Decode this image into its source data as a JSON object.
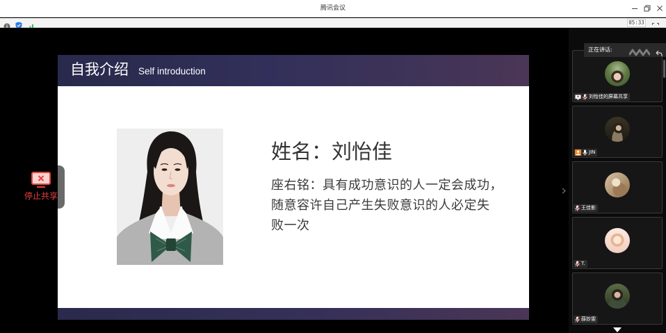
{
  "window": {
    "title": "腾讯会议"
  },
  "toolbar": {
    "timer": "05:33"
  },
  "slide": {
    "title_cn": "自我介绍",
    "title_en": "Self introduction",
    "name_line": "姓名：刘怡佳",
    "motto_lines": [
      "座右铭：具有成功意识的人一定会成功，",
      "随意容许自己产生失败意识的人必定失",
      "败一次"
    ]
  },
  "share_control": {
    "stop_label": "停止共享"
  },
  "speaker_panel": {
    "header": "正在讲话:",
    "participants": [
      {
        "name": "刘怡佳的屏幕共享",
        "badge_icon": "screen-share-icon",
        "mic_icon": "mic-muted-icon"
      },
      {
        "name": "JIN",
        "badge_icon": "host-person-icon",
        "mic_icon": "mic-icon"
      },
      {
        "name": "王佳影",
        "mic_icon": "mic-muted-icon"
      },
      {
        "name": "T.",
        "mic_icon": "mic-muted-icon"
      },
      {
        "name": "薛妙雯",
        "mic_icon": "mic-muted-icon"
      }
    ]
  },
  "icons": {
    "titlebar": [
      "minimize-icon",
      "restore-icon",
      "close-icon"
    ],
    "statusbar": [
      "info-icon",
      "shield-icon",
      "signal-icon",
      "fullscreen-icon"
    ],
    "stage": [
      "stop-share-icon",
      "chevron-right-icon",
      "back-arrow-icon",
      "chevron-down-icon"
    ]
  },
  "colors": {
    "accent_red": "#e8413c",
    "slide_header": "#28294b",
    "signal_green": "#3dbb5c",
    "shield_blue": "#2f7de1",
    "host_orange": "#f0862a"
  }
}
